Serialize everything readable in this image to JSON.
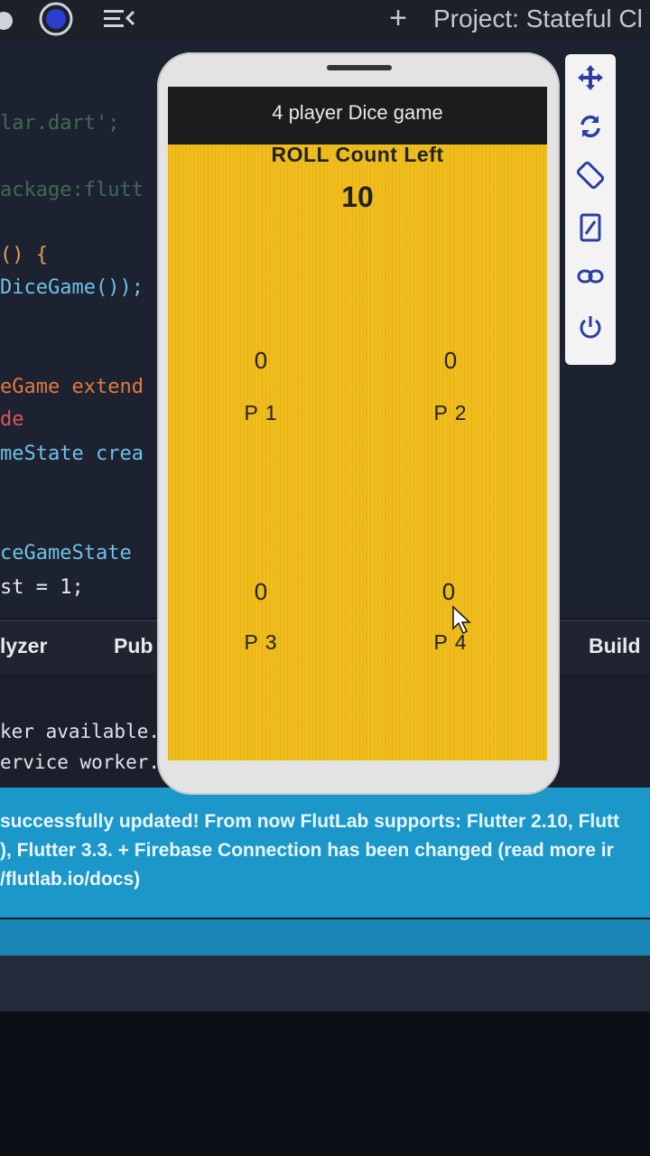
{
  "toolbar": {
    "project_title": "Project: Stateful Cl",
    "add_label": "+"
  },
  "editor": {
    "lines": [
      "lar.dart';",
      "ackage:flutt",
      "() {",
      "DiceGame());",
      "eGame extend",
      "de",
      "meState crea",
      "ceGameState",
      "st = 1;"
    ]
  },
  "panel_tabs": {
    "analyzer": "lyzer",
    "pub": "Pub",
    "build": "Build"
  },
  "console": {
    "lines": [
      "ker available.",
      "ervice worker."
    ]
  },
  "banner": {
    "lines": [
      "successfully updated! From now FlutLab supports: Flutter 2.10, Flutt",
      "), Flutter 3.3. + Firebase Connection has been changed (read more ir",
      "/flutlab.io/docs)"
    ]
  },
  "app": {
    "title": "4 player Dice game",
    "roll_label": "ROLL Count Left",
    "roll_count": "10",
    "background_color": "#f0bd1c",
    "appbar_color": "#1c1c1c",
    "players": [
      {
        "score": "0",
        "name": "P 1"
      },
      {
        "score": "0",
        "name": "P 2"
      },
      {
        "score": "0",
        "name": "P 3"
      },
      {
        "score": "0",
        "name": "P 4"
      }
    ]
  },
  "toolbox": {
    "icons": [
      "move-icon",
      "rotate-icon",
      "screen-rotate-icon",
      "edit-icon",
      "link-icon",
      "power-icon"
    ]
  }
}
